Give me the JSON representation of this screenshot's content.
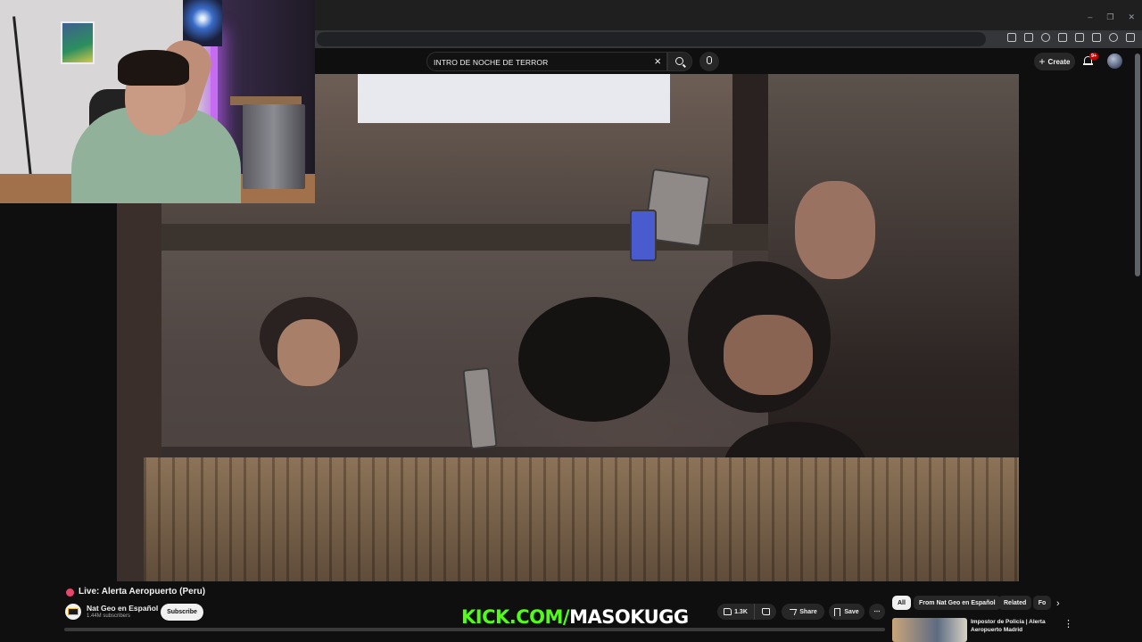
{
  "browser": {
    "window_controls": [
      "–",
      "❐",
      "✕"
    ],
    "toolbar_icons": [
      "translate-icon",
      "cast-icon",
      "bookmark-star-icon",
      "extensions-icon",
      "sidebar-icon",
      "media-icon",
      "profile-icon",
      "menu-icon"
    ]
  },
  "header": {
    "search_query": "INTRO DE NOCHE DE TERROR",
    "create_label": "Create",
    "notification_badge": "9+"
  },
  "video": {
    "title": "Live: Alerta Aeropuerto (Peru)",
    "channel": "Nat Geo en Español",
    "subscribers": "1.44M subscribers",
    "subscribe_label": "Subscribe",
    "likes": "1.3K",
    "share_label": "Share",
    "save_label": "Save"
  },
  "overlay": {
    "kick_prefix": "KICK.COM/",
    "kick_user": "MASOKUGG"
  },
  "sidebar": {
    "chips": [
      "All",
      "From Nat Geo en Español",
      "Related",
      "Fo"
    ],
    "related": [
      {
        "title": "Impostor de Policía | Alerta Aeropuerto Madrid"
      }
    ]
  },
  "colors": {
    "kick_green": "#53fc18",
    "live_dot": "#e8466a",
    "background": "#0f0f0f"
  }
}
